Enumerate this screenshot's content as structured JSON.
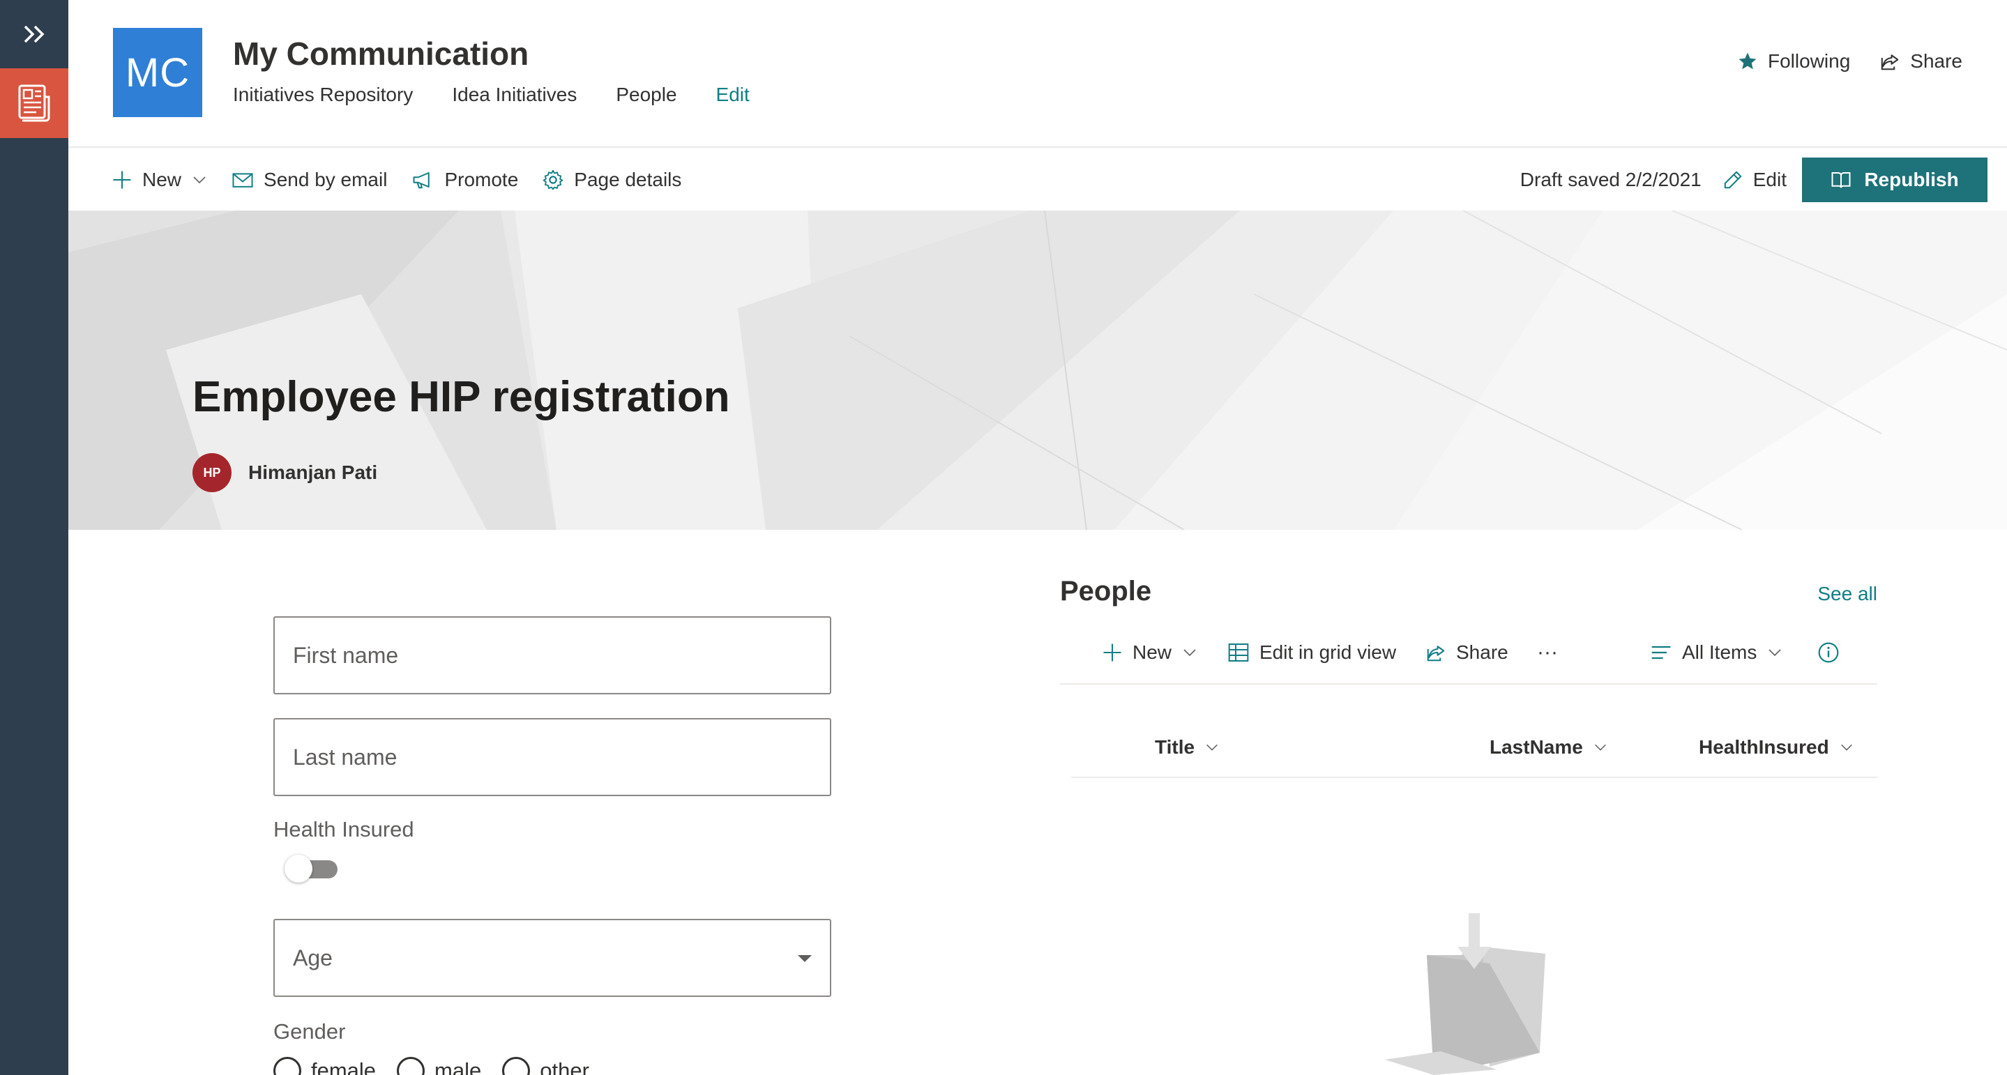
{
  "rail": {
    "expand_icon": "double-chevron-right-icon",
    "app_icon": "newspaper-icon",
    "app_color": "#d9553f"
  },
  "site": {
    "logo_text": "MC",
    "logo_color": "#2f7fd6",
    "title": "My Communication",
    "nav": [
      "Initiatives Repository",
      "Idea Initiatives",
      "People",
      "Edit"
    ],
    "following_label": "Following",
    "share_label": "Share"
  },
  "commandbar": {
    "new_label": "New",
    "send_email_label": "Send by email",
    "promote_label": "Promote",
    "page_details_label": "Page details",
    "draft_status": "Draft saved 2/2/2021",
    "edit_label": "Edit",
    "republish_label": "Republish",
    "accent_color": "#1e7279"
  },
  "hero": {
    "title": "Employee HIP registration",
    "author_initials": "HP",
    "author_name": "Himanjan Pati"
  },
  "form": {
    "first_name_placeholder": "First name",
    "last_name_placeholder": "Last name",
    "health_insured_label": "Health Insured",
    "health_insured_on": false,
    "age_placeholder": "Age",
    "gender_label": "Gender",
    "gender_options": [
      "female",
      "male",
      "other"
    ]
  },
  "people_list": {
    "title": "People",
    "see_all_label": "See all",
    "new_label": "New",
    "grid_view_label": "Edit in grid view",
    "share_label": "Share",
    "more_label": "···",
    "view_label": "All Items",
    "columns": [
      "Title",
      "LastName",
      "HealthInsured"
    ],
    "rows": []
  }
}
